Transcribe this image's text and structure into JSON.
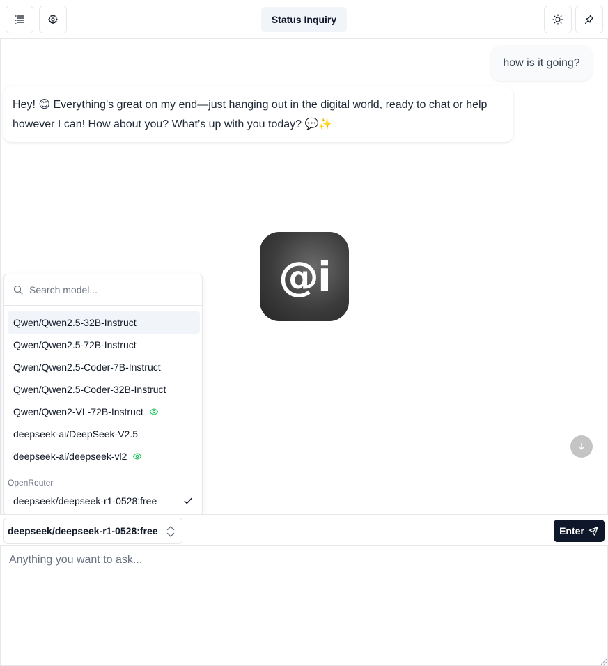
{
  "header": {
    "title": "Status Inquiry",
    "left_buttons": [
      {
        "icon": "list-icon"
      },
      {
        "icon": "gear-icon"
      }
    ],
    "right_buttons": [
      {
        "icon": "sun-icon"
      },
      {
        "icon": "pin-icon"
      }
    ]
  },
  "chat": {
    "messages": [
      {
        "role": "user",
        "text": "how is it going?"
      },
      {
        "role": "assistant",
        "text": "Hey! 😊 Everything's great on my end—just hanging out in the digital world, ready to chat or help however I can! How about you? What’s up with you today? 💬✨"
      }
    ],
    "logo_text": "@i"
  },
  "model_picker": {
    "search_placeholder": "Search model...",
    "items": [
      {
        "label": "Qwen/Qwen2.5-32B-Instruct",
        "vision": false,
        "highlighted": true
      },
      {
        "label": "Qwen/Qwen2.5-72B-Instruct",
        "vision": false
      },
      {
        "label": "Qwen/Qwen2.5-Coder-7B-Instruct",
        "vision": false
      },
      {
        "label": "Qwen/Qwen2.5-Coder-32B-Instruct",
        "vision": false
      },
      {
        "label": "Qwen/Qwen2-VL-72B-Instruct",
        "vision": true
      },
      {
        "label": "deepseek-ai/DeepSeek-V2.5",
        "vision": false
      },
      {
        "label": "deepseek-ai/deepseek-vl2",
        "vision": true
      }
    ],
    "group_label": "OpenRouter",
    "group_items": [
      {
        "label": "deepseek/deepseek-r1-0528:free",
        "selected": true
      }
    ]
  },
  "composer": {
    "selected_model": "deepseek/deepseek-r1-0528:free",
    "send_label": "Enter",
    "placeholder": "Anything you want to ask..."
  },
  "colors": {
    "accent": "#0f172a",
    "vision_icon": "#22c55e",
    "border": "#e5e7eb"
  }
}
